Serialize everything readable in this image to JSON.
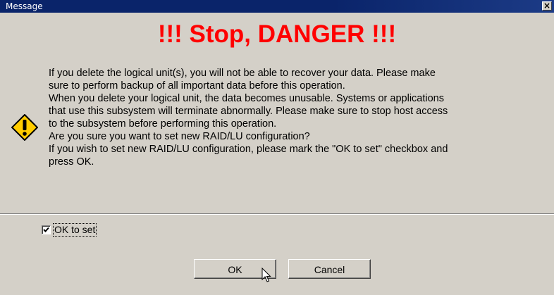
{
  "window": {
    "title": "Message",
    "close_glyph": "×"
  },
  "heading": "!!! Stop, DANGER !!!",
  "message_lines": [
    "If you delete the logical unit(s), you will not be able to recover your data. Please make",
    "sure to perform backup of all important data before this operation.",
    "When you delete your logical unit, the data becomes unusable. Systems or applications",
    "that use this subsystem will terminate abnormally. Please make sure to stop host access",
    "to the subsystem before performing this operation.",
    "Are you sure you want to set new RAID/LU configuration?",
    "If you wish to set new RAID/LU configuration, please mark the \"OK to set\" checkbox and",
    "press OK."
  ],
  "checkbox": {
    "label": "OK to set",
    "checked": true
  },
  "buttons": {
    "ok_label": "OK",
    "cancel_label": "Cancel"
  },
  "icons": {
    "warning": "warning-icon"
  },
  "colors": {
    "title_bar": "#0a246a",
    "heading": "#ff0000",
    "dialog_bg": "#d4d0c8",
    "warning_fill": "#ffcc00"
  }
}
